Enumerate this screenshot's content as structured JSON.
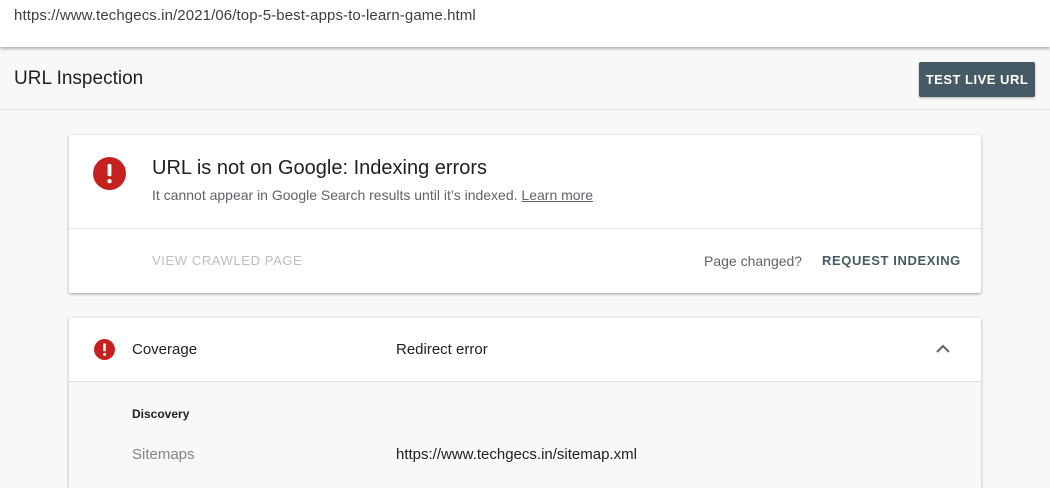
{
  "url_bar": {
    "url": "https://www.techgecs.in/2021/06/top-5-best-apps-to-learn-game.html"
  },
  "header": {
    "title": "URL Inspection",
    "test_live_label": "TEST LIVE URL"
  },
  "status_card": {
    "icon": "error-icon",
    "title": "URL is not on Google: Indexing errors",
    "subtitle": "It cannot appear in Google Search results until it’s indexed.",
    "learn_more": "Learn more",
    "view_crawled_label": "VIEW CRAWLED PAGE",
    "page_changed_text": "Page changed?",
    "request_indexing_label": "REQUEST INDEXING"
  },
  "coverage": {
    "icon": "error-icon",
    "label": "Coverage",
    "value": "Redirect error",
    "expand_icon": "chevron-up-icon",
    "section_title": "Discovery",
    "rows": [
      {
        "label": "Sitemaps",
        "value": "https://www.techgecs.in/sitemap.xml"
      }
    ]
  },
  "colors": {
    "error_red": "#c5221f",
    "button_slate": "#455a64",
    "page_background": "#f8f8f8"
  }
}
